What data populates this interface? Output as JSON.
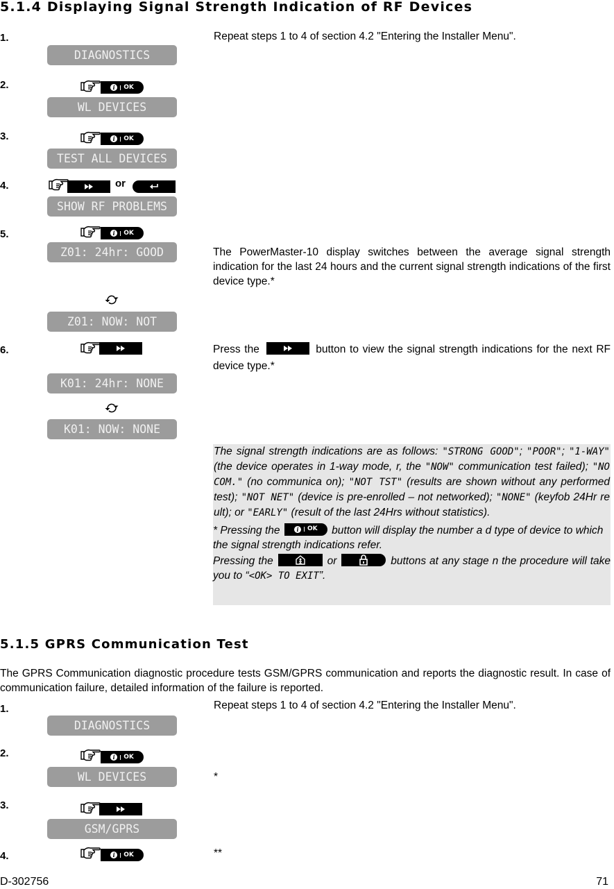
{
  "section1": {
    "heading": "5.1.4 Displaying Signal Strength Indication of RF Devices",
    "steps": [
      {
        "num": "1.",
        "display": "DIAGNOSTICS",
        "text": "Repeat steps 1 to 4 of section 4.2 \"Entering the Installer Menu\"."
      },
      {
        "num": "2.",
        "display": "WL DEVICES"
      },
      {
        "num": "3.",
        "display": "TEST ALL DEVICES"
      },
      {
        "num": "4.",
        "display": "SHOW RF PROBLEMS",
        "or_label": "or"
      },
      {
        "num": "5.",
        "display": "Z01: 24hr: GOOD",
        "display2": "Z01: NOW: NOT",
        "text": "The PowerMaster-10 display switches between the average signal strength indication for the last 24 hours and the current signal strength indications of the first device type.",
        "text_mark": "*"
      },
      {
        "num": "6.",
        "display": "K01: 24hr: NONE",
        "display2": "K01: NOW: NONE",
        "text_before": "Press the",
        "text_after": "button to view the signal strength indications for the next RF device type.*"
      }
    ],
    "note": {
      "p1": [
        {
          "t": "The signal strength indications are as follows: "
        },
        {
          "m": "\"STRONG  GOOD\""
        },
        {
          "t": "; "
        },
        {
          "m": "\"POOR\""
        },
        {
          "t": "; "
        },
        {
          "m": "\"1-WAY\""
        },
        {
          "t": " (the device operates in 1-way mode,  r, the "
        },
        {
          "m": "\"NOW\""
        },
        {
          "t": " communication test failed); "
        },
        {
          "m": "\"NO  COM.\""
        },
        {
          "t": " (no communica  on); "
        },
        {
          "m": "\"NOT  TST\""
        },
        {
          "t": " (results are shown without any performed test); "
        },
        {
          "m": "\"NOT  NET\""
        },
        {
          "t": " (device is pre-enrolled – not networked); "
        },
        {
          "m": "\"NONE\""
        },
        {
          "t": " (keyfob 24Hr re  ult); or "
        },
        {
          "m": "\"EARLY\""
        },
        {
          "t": " (result of the last 24Hrs without statistics)."
        }
      ],
      "p2_mark": "*",
      "p2_before": "Pressing the",
      "p2_after": "button will display the number a  d type of device to which the signal strength indications refer.",
      "p3_before": "Pressing the",
      "p3_or": "or",
      "p3_after": "buttons at any stage  n the procedure will take you to “",
      "p3_code": "<OK>  TO EXIT",
      "p3_end": "”."
    }
  },
  "section2": {
    "heading": "5.1.5 GPRS Communication Test",
    "intro": "The GPRS Communication diagnostic procedure tests GSM/GPRS communication and reports the diagnostic result. In case of communication failure, detailed information of the failure is reported.",
    "steps": [
      {
        "num": "1.",
        "display": "DIAGNOSTICS",
        "text": "Repeat steps 1 to 4 of section 4.2 \"Entering the Installer Menu\"."
      },
      {
        "num": "2.",
        "display": "WL DEVICES",
        "text": "*"
      },
      {
        "num": "3.",
        "display": "GSM/GPRS"
      },
      {
        "num": "4.",
        "text": "**"
      }
    ]
  },
  "buttons": {
    "ok_label": "OK",
    "info_glyph": "i",
    "next_glyph": "▶▶",
    "back_glyph": "↰"
  },
  "icons": {
    "hand": "pointing-hand-icon",
    "cycle": "alternating-display-icon"
  },
  "footer": {
    "doc_id": "D-302756",
    "page": "71"
  }
}
